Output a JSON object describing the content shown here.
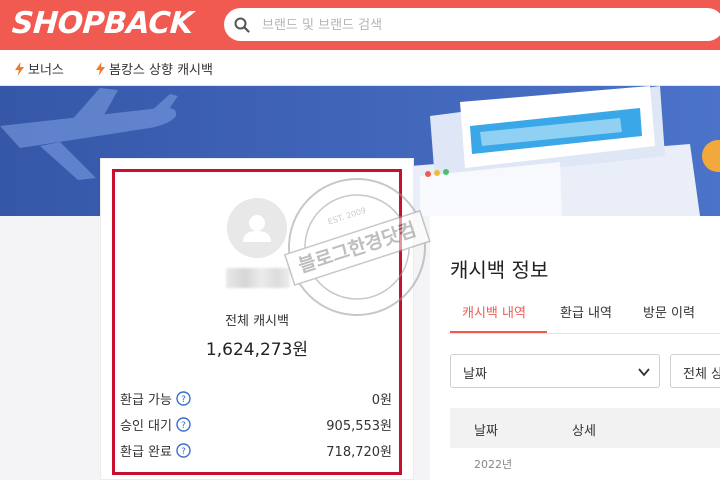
{
  "header": {
    "logo": "SHOPBACK",
    "search_placeholder": "브랜드 및 브랜드 검색",
    "search_icon": "search-icon",
    "accent": "#f05a50"
  },
  "subnav": {
    "items": [
      {
        "label": "보너스",
        "icon": "lightning-icon"
      },
      {
        "label": "봄캉스 상향 캐시백",
        "icon": "lightning-icon"
      }
    ]
  },
  "profile": {
    "total_label": "전체 캐시백",
    "total_value": "1,624,273원",
    "rows": [
      {
        "label": "환급 가능",
        "value": "0원"
      },
      {
        "label": "승인 대기",
        "value": "905,553원"
      },
      {
        "label": "환급 완료",
        "value": "718,720원"
      }
    ],
    "highlight_color": "#c8102e"
  },
  "watermark": {
    "text": "블로그한경닷컴"
  },
  "cashback_panel": {
    "title": "캐시백 정보",
    "tabs": [
      {
        "label": "캐시백 내역",
        "active": true
      },
      {
        "label": "환급 내역",
        "active": false
      },
      {
        "label": "방문 이력",
        "active": false
      }
    ],
    "filter1": "날짜",
    "filter2": "전체 상",
    "table_headers": [
      "날짜",
      "상세"
    ],
    "year_label": "2022년"
  }
}
